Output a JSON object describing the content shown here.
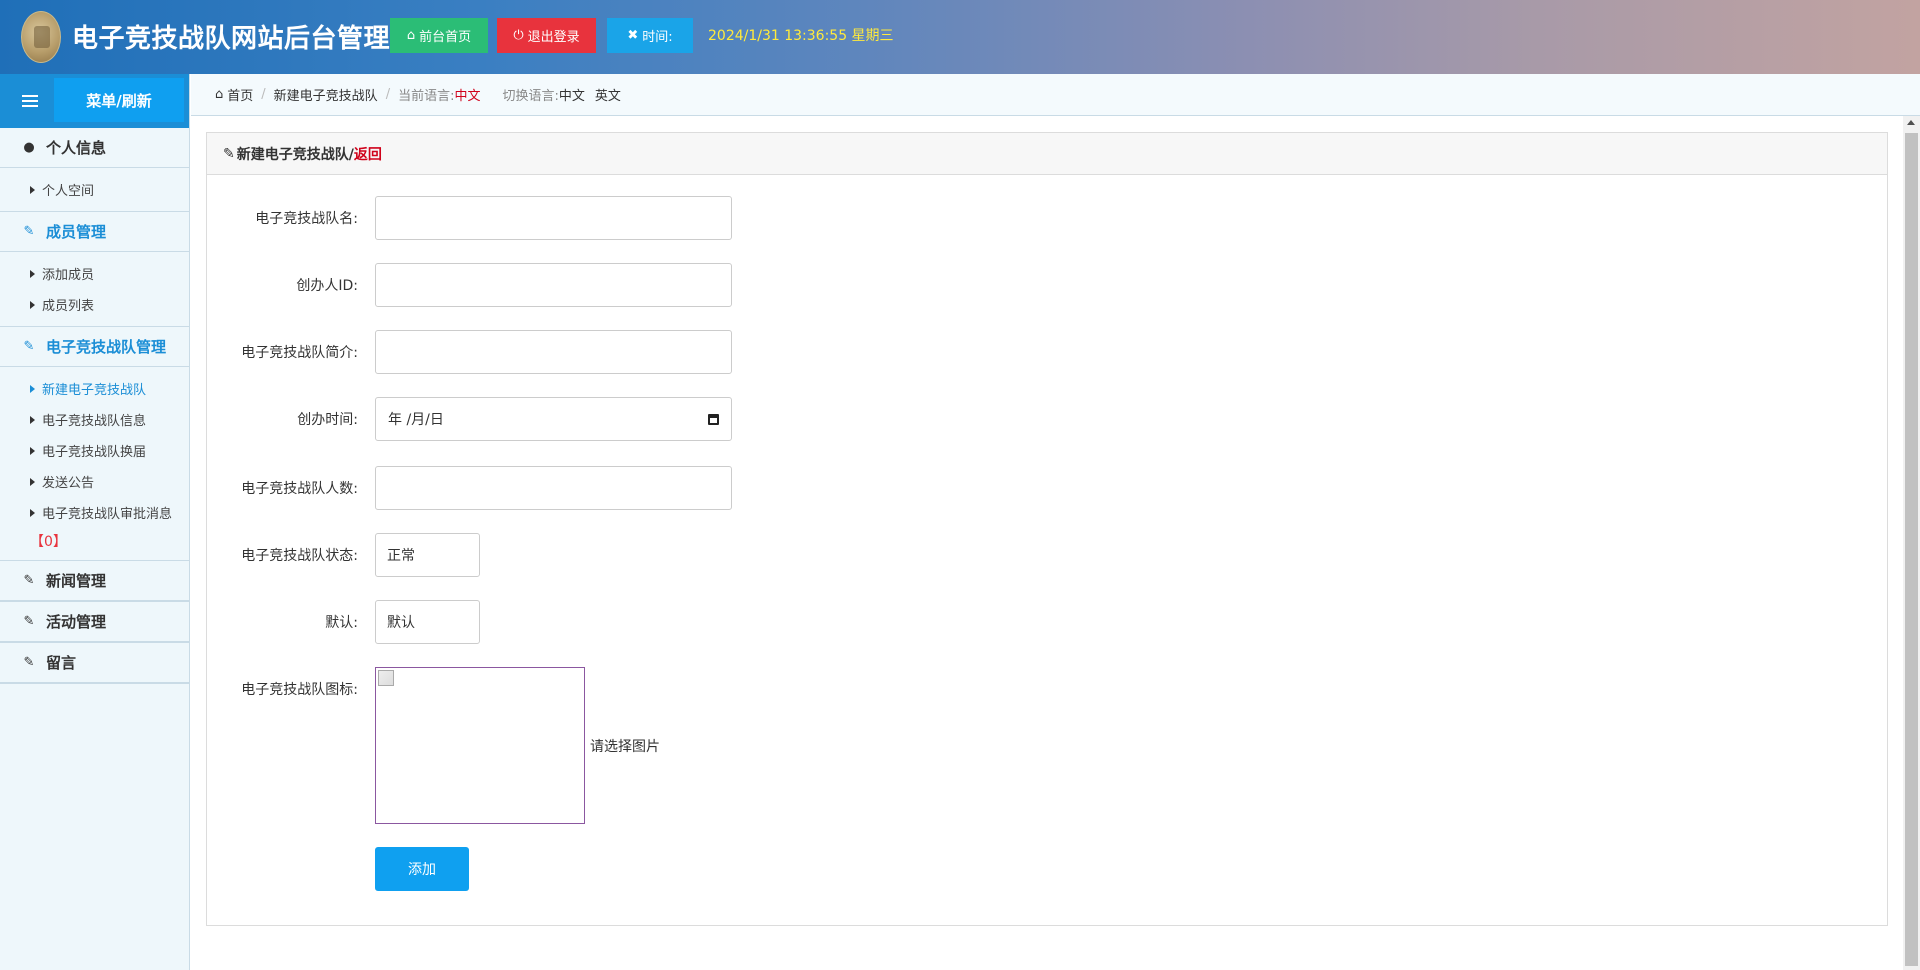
{
  "header": {
    "title": "电子竞技战队网站后台管理",
    "buttons": {
      "home": "前台首页",
      "logout": "退出登录",
      "time": "时间:"
    },
    "datetime": "2024/1/31 13:36:55 星期三",
    "colors": {
      "home": "#2bbd76",
      "logout": "#e8333d",
      "time": "#1aa4e8",
      "datetime": "#ffea3c"
    }
  },
  "sidebar": {
    "menu_refresh": "菜单/刷新",
    "groups": [
      {
        "title": "个人信息",
        "icon": "user-icon",
        "items": [
          "个人空间"
        ]
      },
      {
        "title": "成员管理",
        "icon": "edit-icon",
        "items": [
          "添加成员",
          "成员列表"
        ]
      },
      {
        "title": "电子竞技战队管理",
        "icon": "edit-icon",
        "items": [
          "新建电子竞技战队",
          "电子竞技战队信息",
          "电子竞技战队换届",
          "发送公告",
          "电子竞技战队审批消息"
        ],
        "badge": "【0】",
        "active_item": "新建电子竞技战队"
      },
      {
        "title": "新闻管理",
        "icon": "edit-icon"
      },
      {
        "title": "活动管理",
        "icon": "edit-icon"
      },
      {
        "title": "留言",
        "icon": "edit-icon"
      }
    ]
  },
  "breadcrumb": {
    "home": "首页",
    "current": "新建电子竞技战队",
    "lang_label": "当前语言:",
    "lang_value": "中文",
    "switch_label": "切换语言:",
    "switch_zh": "中文",
    "switch_en": "英文"
  },
  "panel": {
    "title": "新建电子竞技战队/",
    "back": "返回"
  },
  "form": {
    "name_label": "电子竞技战队名:",
    "name_value": "",
    "founder_label": "创办人ID:",
    "founder_value": "",
    "intro_label": "电子竞技战队简介:",
    "intro_value": "",
    "date_label": "创办时间:",
    "date_placeholder": "年 /月/日",
    "count_label": "电子竞技战队人数:",
    "count_value": "",
    "status_label": "电子竞技战队状态:",
    "status_value": "正常",
    "default_label": "默认:",
    "default_value": "默认",
    "icon_label": "电子竞技战队图标:",
    "icon_hint": "请选择图片",
    "submit": "添加"
  }
}
